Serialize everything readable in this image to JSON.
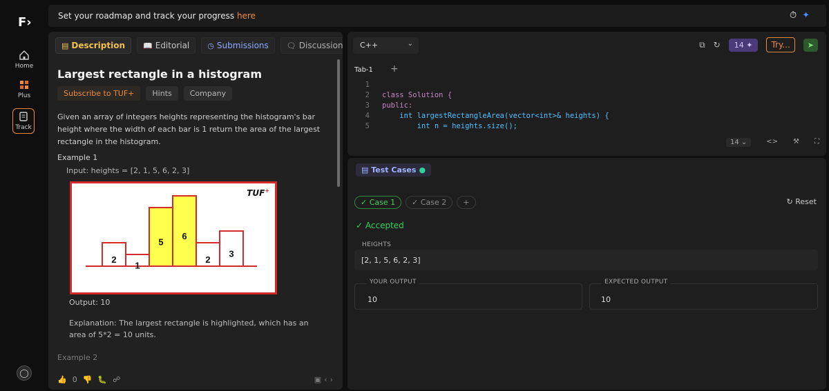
{
  "banner": {
    "text": "Set your roadmap and track your progress ",
    "link": "here"
  },
  "rail": {
    "home": "Home",
    "plus": "Plus",
    "track": "Track"
  },
  "tabs": {
    "description": "Description",
    "editorial": "Editorial",
    "submissions": "Submissions",
    "discussion": "Discussion"
  },
  "problem": {
    "title": "Largest rectangle in a histogram",
    "chips": {
      "subscribe": "Subscribe to TUF+",
      "hints": "Hints",
      "company": "Company"
    },
    "description": "Given an array of integers heights representing the histogram's bar height where the width of each bar is 1 return the area of the largest rectangle in the histogram.",
    "example1": "Example 1",
    "input": "Input: heights = [2, 1, 5, 6, 2, 3]",
    "figure_logo": "TUF",
    "figure_logo_sup": "+",
    "bars": [
      {
        "value": 2,
        "label": "2"
      },
      {
        "value": 1,
        "label": "1"
      },
      {
        "value": 5,
        "label": "5"
      },
      {
        "value": 6,
        "label": "6"
      },
      {
        "value": 2,
        "label": "2"
      },
      {
        "value": 3,
        "label": "3"
      }
    ],
    "highlight": [
      2,
      3
    ],
    "output": "Output: 10",
    "explanation": "Explanation: The largest rectangle is highlighted, which has an area of 5*2 = 10 units.",
    "example2": "Example 2",
    "likes": "0"
  },
  "editor": {
    "language": "C++",
    "tab": "Tab-1",
    "streak": "14",
    "try": "Try...",
    "font_size": "14",
    "lines": [
      {
        "n": "1",
        "code": ""
      },
      {
        "n": "2",
        "code": "class Solution {"
      },
      {
        "n": "3",
        "code": "public:"
      },
      {
        "n": "4",
        "code": "    int largestRectangleArea(vector<int>& heights) {"
      },
      {
        "n": "5",
        "code": "        int n = heights.size();"
      }
    ]
  },
  "tests": {
    "title": "Test Cases",
    "case1": "Case 1",
    "case2": "Case 2",
    "reset": "Reset",
    "status": "Accepted",
    "heights_label": "HEIGHTS",
    "heights_value": "[2, 1, 5, 6, 2, 3]",
    "your_output_label": "YOUR OUTPUT",
    "your_output": "10",
    "expected_output_label": "EXPECTED OUTPUT",
    "expected_output": "10"
  },
  "colors": {
    "accent": "#f08a3c",
    "success": "#2fd35a",
    "highlight": "#ffff4d",
    "frame": "#d42a2a"
  }
}
